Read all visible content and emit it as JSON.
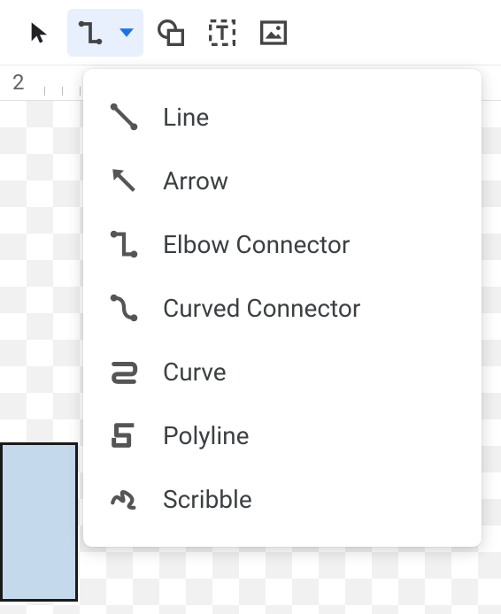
{
  "toolbar": {
    "select_tool": "select",
    "line_tool": "line",
    "shape_tool": "shape",
    "text_tool": "text",
    "image_tool": "image"
  },
  "ruler": {
    "number": "2"
  },
  "line_menu": {
    "items": [
      {
        "label": "Line"
      },
      {
        "label": "Arrow"
      },
      {
        "label": "Elbow Connector"
      },
      {
        "label": "Curved Connector"
      },
      {
        "label": "Curve"
      },
      {
        "label": "Polyline"
      },
      {
        "label": "Scribble"
      }
    ]
  }
}
